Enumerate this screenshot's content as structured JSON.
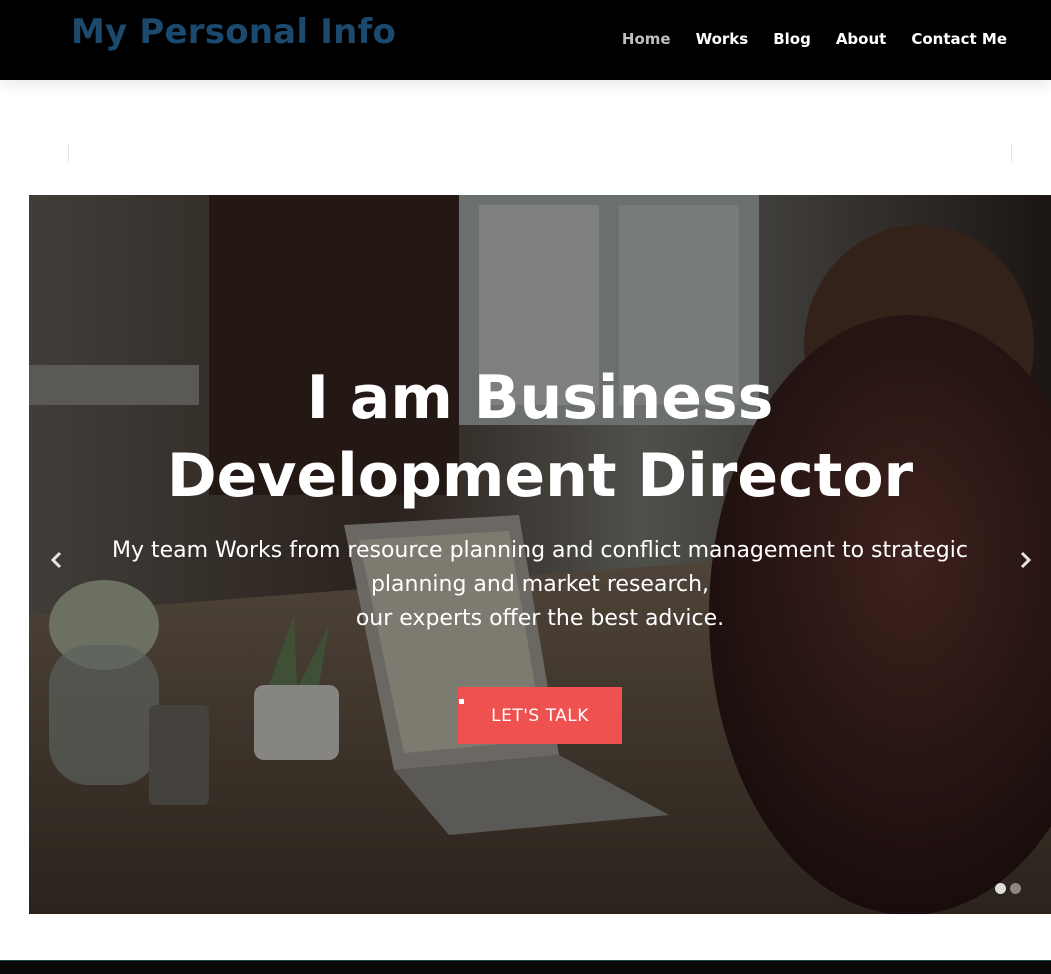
{
  "brand": "My Personal Info",
  "nav": {
    "items": [
      {
        "label": "Home",
        "active": true
      },
      {
        "label": "Works",
        "active": false
      },
      {
        "label": "Blog",
        "active": false
      },
      {
        "label": "About",
        "active": false
      },
      {
        "label": "Contact Me",
        "active": false
      }
    ]
  },
  "hero": {
    "title_line1": "I am Business",
    "title_line2": "Development Director",
    "subtitle_line1": "My team Works from resource planning and conflict management to strategic",
    "subtitle_line2": "planning and market research,",
    "subtitle_line3": "our experts offer the best advice.",
    "cta_label": "LET'S TALK",
    "prev_icon": "chevron-left-icon",
    "next_icon": "chevron-right-icon",
    "slide_count": 2,
    "active_slide": 1
  },
  "colors": {
    "navbar_bg": "#000000",
    "brand": "#1b4a6e",
    "nav_active": "#bfbfbf",
    "cta_bg": "#ef5050"
  }
}
